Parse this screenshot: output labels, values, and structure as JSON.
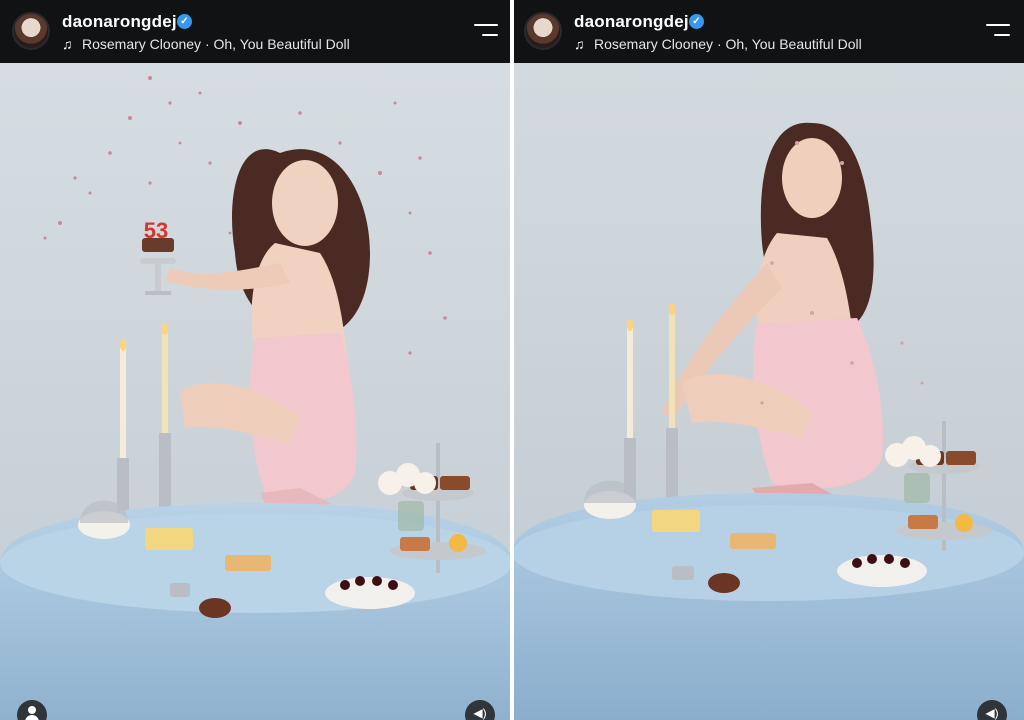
{
  "posts": [
    {
      "username": "daonarongdej",
      "verified_icon": "verified-badge-icon",
      "music_icon": "music-note-icon",
      "song": "Rosemary Clooney · Oh, You Beautiful Doll",
      "cake_number": "53"
    },
    {
      "username": "daonarongdej",
      "verified_icon": "verified-badge-icon",
      "music_icon": "music-note-icon",
      "song": "Rosemary Clooney · Oh, You Beautiful Doll"
    }
  ],
  "colors": {
    "header_bg": "#111214",
    "verified": "#3897f0",
    "backdrop": "#d3dadf",
    "tablecloth": "#a9c6df",
    "dress": "#f3c9cf"
  }
}
